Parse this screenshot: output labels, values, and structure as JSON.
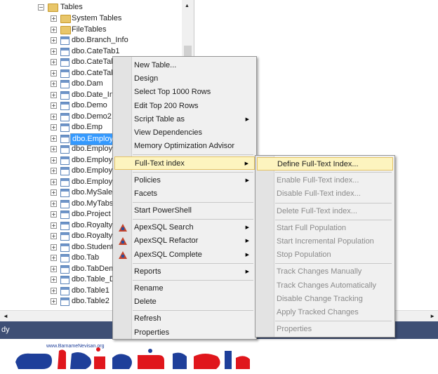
{
  "tree": {
    "root_label": "Tables",
    "items": [
      {
        "label": "System Tables",
        "kind": "folder"
      },
      {
        "label": "FileTables",
        "kind": "folder"
      },
      {
        "label": "dbo.Branch_Info",
        "kind": "table"
      },
      {
        "label": "dbo.CateTab1",
        "kind": "table"
      },
      {
        "label": "dbo.CateTab",
        "kind": "table"
      },
      {
        "label": "dbo.CateTab",
        "kind": "table"
      },
      {
        "label": "dbo.Dam",
        "kind": "table"
      },
      {
        "label": "dbo.Date_Int",
        "kind": "table"
      },
      {
        "label": "dbo.Demo",
        "kind": "table"
      },
      {
        "label": "dbo.Demo2",
        "kind": "table"
      },
      {
        "label": "dbo.Emp",
        "kind": "table"
      },
      {
        "label": "dbo.Employ",
        "kind": "table",
        "selected": true
      },
      {
        "label": "dbo.Employ",
        "kind": "table"
      },
      {
        "label": "dbo.Employ",
        "kind": "table"
      },
      {
        "label": "dbo.Employ",
        "kind": "table"
      },
      {
        "label": "dbo.Employ",
        "kind": "table"
      },
      {
        "label": "dbo.MySales",
        "kind": "table"
      },
      {
        "label": "dbo.MyTabs",
        "kind": "table"
      },
      {
        "label": "dbo.Project",
        "kind": "table"
      },
      {
        "label": "dbo.Royalty",
        "kind": "table"
      },
      {
        "label": "dbo.Royalty",
        "kind": "table"
      },
      {
        "label": "dbo.Student",
        "kind": "table"
      },
      {
        "label": "dbo.Tab",
        "kind": "table"
      },
      {
        "label": "dbo.TabDem",
        "kind": "table"
      },
      {
        "label": "dbo.Table_D",
        "kind": "table"
      },
      {
        "label": "dbo.Table1",
        "kind": "table"
      },
      {
        "label": "dbo.Table2",
        "kind": "table"
      }
    ]
  },
  "status": {
    "text": "dy"
  },
  "context_menu": {
    "items": [
      {
        "label": "New Table..."
      },
      {
        "label": "Design"
      },
      {
        "label": "Select Top 1000 Rows"
      },
      {
        "label": "Edit Top 200 Rows"
      },
      {
        "label": "Script Table as",
        "submenu": true
      },
      {
        "label": "View Dependencies"
      },
      {
        "label": "Memory Optimization Advisor"
      },
      {
        "sep": true
      },
      {
        "label": "Full-Text index",
        "submenu": true,
        "highlight": true
      },
      {
        "sep": true
      },
      {
        "label": "Policies",
        "submenu": true
      },
      {
        "label": "Facets"
      },
      {
        "sep": true
      },
      {
        "label": "Start PowerShell"
      },
      {
        "sep": true
      },
      {
        "label": "ApexSQL Search",
        "submenu": true,
        "icon": "apexsql-icon"
      },
      {
        "label": "ApexSQL Refactor",
        "submenu": true,
        "icon": "apexsql-icon"
      },
      {
        "label": "ApexSQL Complete",
        "submenu": true,
        "icon": "apexsql-icon"
      },
      {
        "sep": true
      },
      {
        "label": "Reports",
        "submenu": true
      },
      {
        "sep": true
      },
      {
        "label": "Rename"
      },
      {
        "label": "Delete"
      },
      {
        "sep": true
      },
      {
        "label": "Refresh"
      },
      {
        "label": "Properties"
      }
    ]
  },
  "fulltext_menu": {
    "items": [
      {
        "label": "Define Full-Text Index...",
        "highlight": true
      },
      {
        "sep": true
      },
      {
        "label": "Enable Full-Text index...",
        "disabled": true
      },
      {
        "label": "Disable Full-Text index...",
        "disabled": true
      },
      {
        "sep": true
      },
      {
        "label": "Delete Full-Text index...",
        "disabled": true
      },
      {
        "sep": true
      },
      {
        "label": "Start Full Population",
        "disabled": true
      },
      {
        "label": "Start Incremental Population",
        "disabled": true
      },
      {
        "label": "Stop Population",
        "disabled": true
      },
      {
        "sep": true
      },
      {
        "label": "Track Changes Manually",
        "disabled": true
      },
      {
        "label": "Track Changes Automatically",
        "disabled": true
      },
      {
        "label": "Disable Change Tracking",
        "disabled": true
      },
      {
        "label": "Apply Tracked Changes",
        "disabled": true
      },
      {
        "sep": true
      },
      {
        "label": "Properties",
        "disabled": true
      }
    ]
  },
  "watermark": {
    "url_text": "www.BarnameNevisan.org",
    "brand_text": "برنامه نویسان",
    "colors": {
      "red": "#e0161c",
      "blue": "#1e3f9a"
    }
  }
}
